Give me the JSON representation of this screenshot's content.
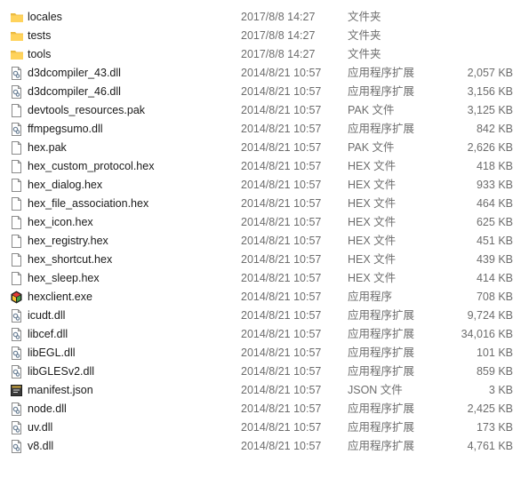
{
  "files": [
    {
      "name": "locales",
      "date": "2017/8/8 14:27",
      "type": "文件夹",
      "size": "",
      "icon": "folder-icon"
    },
    {
      "name": "tests",
      "date": "2017/8/8 14:27",
      "type": "文件夹",
      "size": "",
      "icon": "folder-icon"
    },
    {
      "name": "tools",
      "date": "2017/8/8 14:27",
      "type": "文件夹",
      "size": "",
      "icon": "folder-icon"
    },
    {
      "name": "d3dcompiler_43.dll",
      "date": "2014/8/21 10:57",
      "type": "应用程序扩展",
      "size": "2,057 KB",
      "icon": "dll-icon"
    },
    {
      "name": "d3dcompiler_46.dll",
      "date": "2014/8/21 10:57",
      "type": "应用程序扩展",
      "size": "3,156 KB",
      "icon": "dll-icon"
    },
    {
      "name": "devtools_resources.pak",
      "date": "2014/8/21 10:57",
      "type": "PAK 文件",
      "size": "3,125 KB",
      "icon": "file-icon"
    },
    {
      "name": "ffmpegsumo.dll",
      "date": "2014/8/21 10:57",
      "type": "应用程序扩展",
      "size": "842 KB",
      "icon": "dll-icon"
    },
    {
      "name": "hex.pak",
      "date": "2014/8/21 10:57",
      "type": "PAK 文件",
      "size": "2,626 KB",
      "icon": "file-icon"
    },
    {
      "name": "hex_custom_protocol.hex",
      "date": "2014/8/21 10:57",
      "type": "HEX 文件",
      "size": "418 KB",
      "icon": "file-icon"
    },
    {
      "name": "hex_dialog.hex",
      "date": "2014/8/21 10:57",
      "type": "HEX 文件",
      "size": "933 KB",
      "icon": "file-icon"
    },
    {
      "name": "hex_file_association.hex",
      "date": "2014/8/21 10:57",
      "type": "HEX 文件",
      "size": "464 KB",
      "icon": "file-icon"
    },
    {
      "name": "hex_icon.hex",
      "date": "2014/8/21 10:57",
      "type": "HEX 文件",
      "size": "625 KB",
      "icon": "file-icon"
    },
    {
      "name": "hex_registry.hex",
      "date": "2014/8/21 10:57",
      "type": "HEX 文件",
      "size": "451 KB",
      "icon": "file-icon"
    },
    {
      "name": "hex_shortcut.hex",
      "date": "2014/8/21 10:57",
      "type": "HEX 文件",
      "size": "439 KB",
      "icon": "file-icon"
    },
    {
      "name": "hex_sleep.hex",
      "date": "2014/8/21 10:57",
      "type": "HEX 文件",
      "size": "414 KB",
      "icon": "file-icon"
    },
    {
      "name": "hexclient.exe",
      "date": "2014/8/21 10:57",
      "type": "应用程序",
      "size": "708 KB",
      "icon": "exe-icon"
    },
    {
      "name": "icudt.dll",
      "date": "2014/8/21 10:57",
      "type": "应用程序扩展",
      "size": "9,724 KB",
      "icon": "dll-icon"
    },
    {
      "name": "libcef.dll",
      "date": "2014/8/21 10:57",
      "type": "应用程序扩展",
      "size": "34,016 KB",
      "icon": "dll-icon"
    },
    {
      "name": "libEGL.dll",
      "date": "2014/8/21 10:57",
      "type": "应用程序扩展",
      "size": "101 KB",
      "icon": "dll-icon"
    },
    {
      "name": "libGLESv2.dll",
      "date": "2014/8/21 10:57",
      "type": "应用程序扩展",
      "size": "859 KB",
      "icon": "dll-icon"
    },
    {
      "name": "manifest.json",
      "date": "2014/8/21 10:57",
      "type": "JSON 文件",
      "size": "3 KB",
      "icon": "json-icon"
    },
    {
      "name": "node.dll",
      "date": "2014/8/21 10:57",
      "type": "应用程序扩展",
      "size": "2,425 KB",
      "icon": "dll-icon"
    },
    {
      "name": "uv.dll",
      "date": "2014/8/21 10:57",
      "type": "应用程序扩展",
      "size": "173 KB",
      "icon": "dll-icon"
    },
    {
      "name": "v8.dll",
      "date": "2014/8/21 10:57",
      "type": "应用程序扩展",
      "size": "4,761 KB",
      "icon": "dll-icon"
    }
  ]
}
